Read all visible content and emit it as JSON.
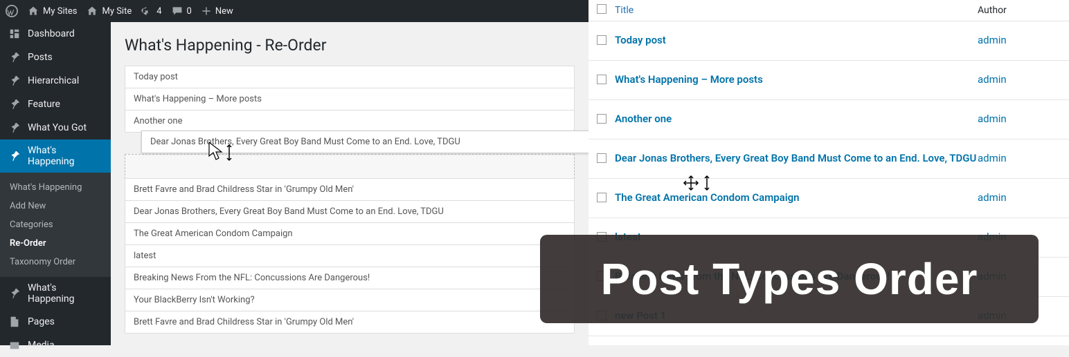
{
  "adminbar": {
    "mysites": "My Sites",
    "mysite": "My Site",
    "updates": "4",
    "comments": "0",
    "new": "New"
  },
  "sidebar": {
    "dashboard": "Dashboard",
    "posts": "Posts",
    "hierarchical": "Hierarchical",
    "feature": "Feature",
    "whatyougot": "What You Got",
    "whatshappening": "What's Happening",
    "submenu": {
      "whatshappening": "What's Happening",
      "addnew": "Add New",
      "categories": "Categories",
      "reorder": "Re-Order",
      "taxorder": "Taxonomy Order"
    },
    "whatshappening2": "What's Happening",
    "pages": "Pages",
    "media": "Media"
  },
  "page_title": "What's Happening - Re-Order",
  "sort_items": [
    "Today post",
    "What's Happening – More posts",
    "Another one",
    "Dear Jonas Brothers, Every Great Boy Band Must Come to an End. Love, TDGU",
    "Brett Favre and Brad Childress Star in 'Grumpy Old Men'",
    "Dear Jonas Brothers, Every Great Boy Band Must Come to an End. Love, TDGU",
    "The Great American Condom Campaign",
    "latest",
    "Breaking News From the NFL: Concussions Are Dangerous!",
    "Your BlackBerry Isn't Working?",
    "Brett Favre and Brad Childress Star in 'Grumpy Old Men'"
  ],
  "right_table": {
    "head_title": "Title",
    "head_author": "Author",
    "rows": [
      {
        "title": "Today post",
        "author": "admin"
      },
      {
        "title": "What's Happening – More posts",
        "author": "admin"
      },
      {
        "title": "Another one",
        "author": "admin"
      },
      {
        "title": "Dear Jonas Brothers, Every Great Boy Band Must Come to an End. Love, TDGU",
        "author": "admin"
      },
      {
        "title": "The Great American Condom Campaign",
        "author": "admin"
      },
      {
        "title": "latest",
        "author": "admin"
      },
      {
        "title": "Breaking News From the NFL: Concussions Are Dangerous!",
        "author": "admin"
      },
      {
        "title": "new Post 1",
        "author": "admin"
      }
    ]
  },
  "banner_text": "Post Types Order"
}
